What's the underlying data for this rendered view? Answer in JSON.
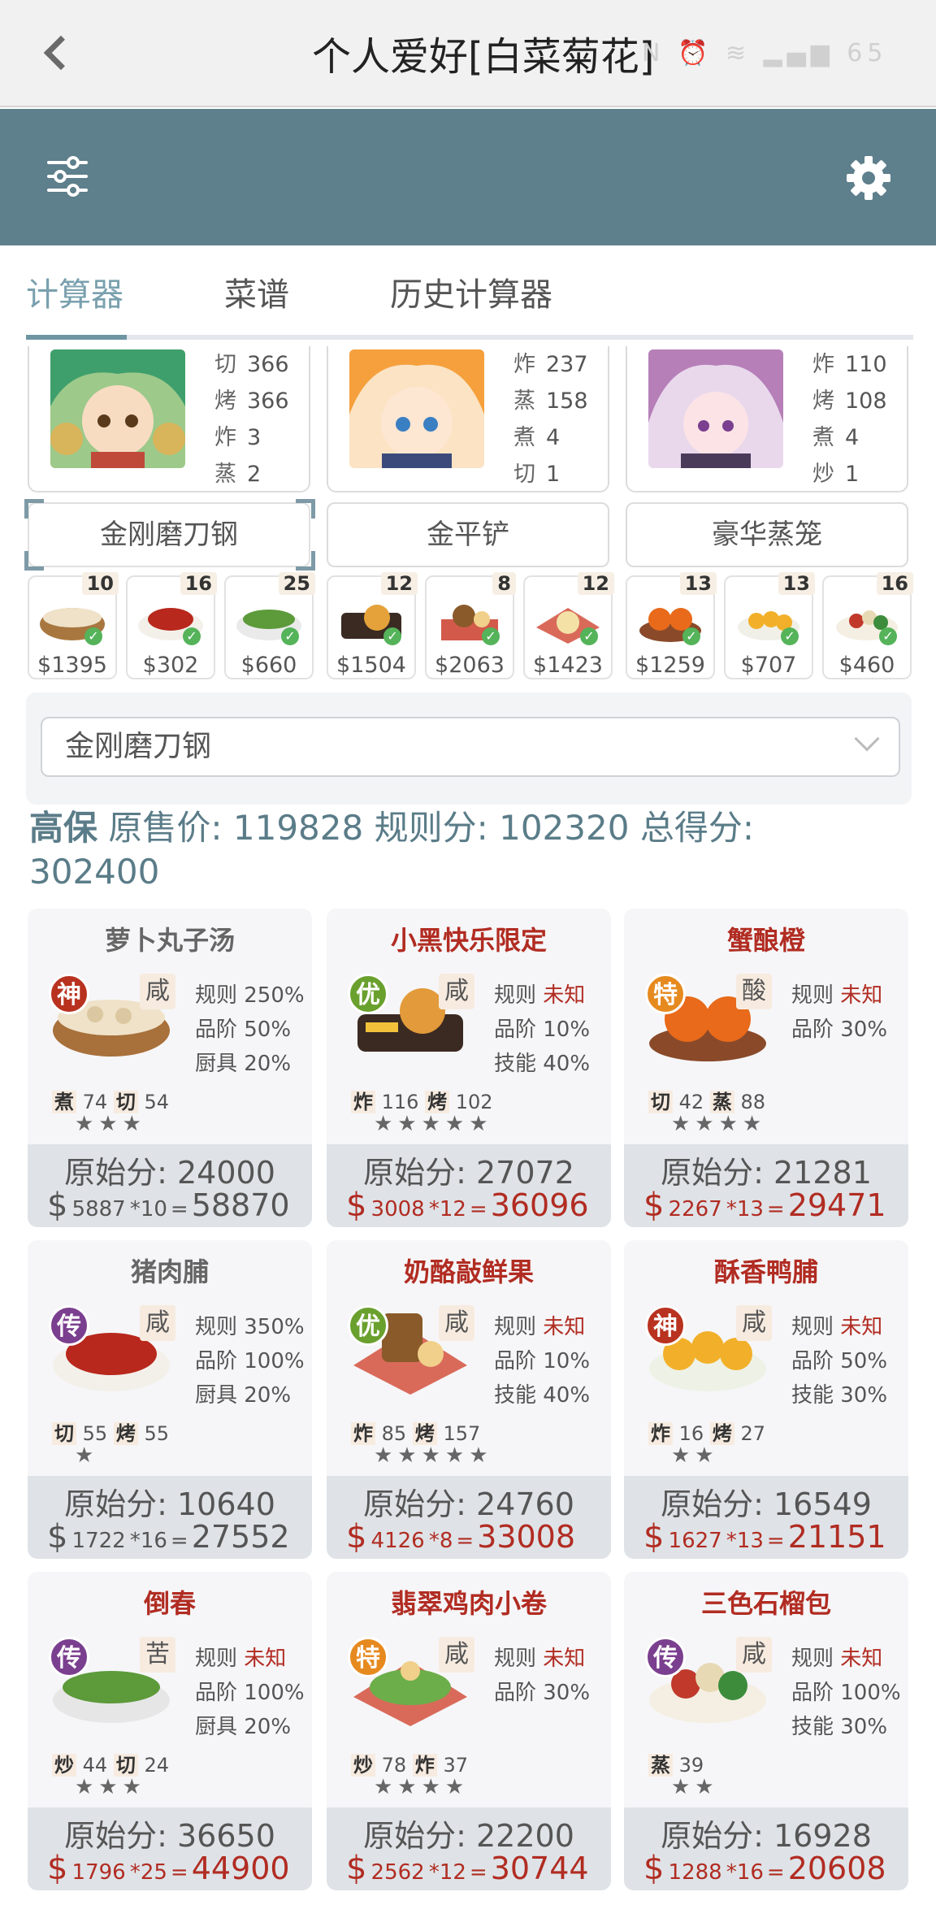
{
  "status": {
    "title": "个人爱好[白菜菊花]",
    "icons": "N ⏰ ≋ ▂▄▆ 65"
  },
  "tabs": [
    {
      "label": "计算器"
    },
    {
      "label": "菜谱"
    },
    {
      "label": "历史计算器"
    }
  ],
  "chefs": [
    {
      "skills": [
        {
          "k": "切",
          "v": "366"
        },
        {
          "k": "烤",
          "v": "366"
        },
        {
          "k": "炸",
          "v": "3"
        },
        {
          "k": "蒸",
          "v": "2"
        }
      ]
    },
    {
      "skills": [
        {
          "k": "炸",
          "v": "237"
        },
        {
          "k": "蒸",
          "v": "158"
        },
        {
          "k": "煮",
          "v": "4"
        },
        {
          "k": "切",
          "v": "1"
        }
      ]
    },
    {
      "skills": [
        {
          "k": "炸",
          "v": "110"
        },
        {
          "k": "烤",
          "v": "108"
        },
        {
          "k": "煮",
          "v": "4"
        },
        {
          "k": "炒",
          "v": "1"
        }
      ]
    }
  ],
  "equipment": [
    {
      "label": "金刚磨刀钢"
    },
    {
      "label": "金平铲"
    },
    {
      "label": "豪华蒸笼"
    }
  ],
  "dish_tiles": [
    {
      "count": "10",
      "price": "$1395"
    },
    {
      "count": "16",
      "price": "$302"
    },
    {
      "count": "25",
      "price": "$660"
    },
    {
      "count": "12",
      "price": "$1504"
    },
    {
      "count": "8",
      "price": "$2063"
    },
    {
      "count": "12",
      "price": "$1423"
    },
    {
      "count": "13",
      "price": "$1259"
    },
    {
      "count": "13",
      "price": "$707"
    },
    {
      "count": "16",
      "price": "$460"
    }
  ],
  "select": {
    "value": "金刚磨刀钢"
  },
  "summary": {
    "label": "高保",
    "orig_label": "原售价:",
    "orig_value": "119828",
    "rule_label": "规则分:",
    "rule_value": "102320",
    "total_label": "总得分:",
    "total_value": "302400"
  },
  "cards": [
    {
      "name": "萝卜丸子汤",
      "badge": "神",
      "flavor": "咸",
      "r1": "规则 250%",
      "r2": "品阶 50%",
      "r3": "厨具 20%",
      "sk1": "煮",
      "v1": "74",
      "sk2": "切",
      "v2": "54",
      "stars": "★★★",
      "orig": "原始分: 24000",
      "base": "5887",
      "mult": "*10",
      "eq": "=",
      "total": "58870"
    },
    {
      "name": "小黑快乐限定",
      "badge": "优",
      "flavor": "咸",
      "r1a": "规则 ",
      "r1b": "未知",
      "r2": "品阶 10%",
      "r3": "技能 40%",
      "sk1": "炸",
      "v1": "116",
      "sk2": "烤",
      "v2": "102",
      "stars": "★★★★★",
      "orig": "原始分: 27072",
      "base": "3008",
      "mult": "*12",
      "eq": "=",
      "total": "36096"
    },
    {
      "name": "蟹酿橙",
      "badge": "特",
      "flavor": "酸",
      "r1a": "规则 ",
      "r1b": "未知",
      "r2": "品阶 30%",
      "r3": "",
      "sk1": "切",
      "v1": "42",
      "sk2": "蒸",
      "v2": "88",
      "stars": "★★★★",
      "orig": "原始分: 21281",
      "base": "2267",
      "mult": "*13",
      "eq": "=",
      "total": "29471"
    },
    {
      "name": "猪肉脯",
      "badge": "传",
      "flavor": "咸",
      "r1": "规则 350%",
      "r2": "品阶 100%",
      "r3": "厨具 20%",
      "sk1": "切",
      "v1": "55",
      "sk2": "烤",
      "v2": "55",
      "stars": "★",
      "orig": "原始分: 10640",
      "base": "1722",
      "mult": "*16",
      "eq": "=",
      "total": "27552"
    },
    {
      "name": "奶酪敲鲜果",
      "badge": "优",
      "flavor": "咸",
      "r1a": "规则 ",
      "r1b": "未知",
      "r2": "品阶 10%",
      "r3": "技能 40%",
      "sk1": "炸",
      "v1": "85",
      "sk2": "烤",
      "v2": "157",
      "stars": "★★★★★",
      "orig": "原始分: 24760",
      "base": "4126",
      "mult": "*8",
      "eq": "=",
      "total": "33008"
    },
    {
      "name": "酥香鸭脯",
      "badge": "神",
      "flavor": "咸",
      "r1a": "规则 ",
      "r1b": "未知",
      "r2": "品阶 50%",
      "r3": "技能 30%",
      "sk1": "炸",
      "v1": "16",
      "sk2": "烤",
      "v2": "27",
      "stars": "★★",
      "orig": "原始分: 16549",
      "base": "1627",
      "mult": "*13",
      "eq": "=",
      "total": "21151"
    },
    {
      "name": "倒春",
      "badge": "传",
      "flavor": "苦",
      "r1a": "规则 ",
      "r1b": "未知",
      "r2": "品阶 100%",
      "r3": "厨具 20%",
      "sk1": "炒",
      "v1": "44",
      "sk2": "切",
      "v2": "24",
      "stars": "★★★",
      "orig": "原始分: 36650",
      "base": "1796",
      "mult": "*25",
      "eq": "=",
      "total": "44900"
    },
    {
      "name": "翡翠鸡肉小卷",
      "badge": "特",
      "flavor": "咸",
      "r1a": "规则 ",
      "r1b": "未知",
      "r2": "品阶 30%",
      "r3": "",
      "sk1": "炒",
      "v1": "78",
      "sk2": "炸",
      "v2": "37",
      "stars": "★★★★",
      "orig": "原始分: 22200",
      "base": "2562",
      "mult": "*12",
      "eq": "=",
      "total": "30744"
    },
    {
      "name": "三色石榴包",
      "badge": "传",
      "flavor": "咸",
      "r1a": "规则 ",
      "r1b": "未知",
      "r2": "品阶 100%",
      "r3": "技能 30%",
      "sk1": "蒸",
      "v1": "39",
      "sk2": "",
      "v2": "",
      "stars": "★★",
      "orig": "原始分: 16928",
      "base": "1288",
      "mult": "*16",
      "eq": "=",
      "total": "20608"
    }
  ],
  "colors": {
    "header": "#5e7f8c",
    "accent": "#6f95a3",
    "red": "#b12c22",
    "badge_shen": "#b8321f",
    "badge_you": "#6aa02e",
    "badge_te": "#e68a1f",
    "badge_chuan": "#7b3f8f"
  }
}
